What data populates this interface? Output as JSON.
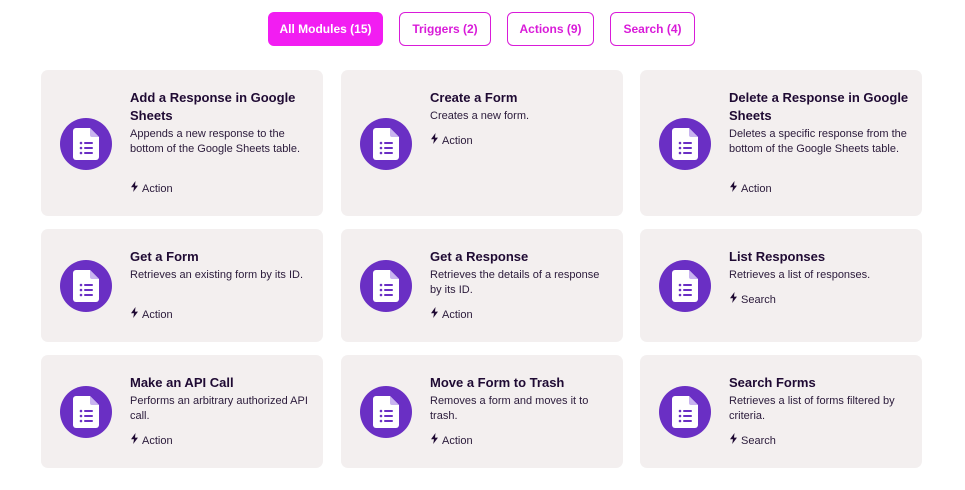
{
  "filters": [
    {
      "label": "All Modules (15)",
      "active": true
    },
    {
      "label": "Triggers (2)",
      "active": false
    },
    {
      "label": "Actions (9)",
      "active": false
    },
    {
      "label": "Search (4)",
      "active": false
    }
  ],
  "colors": {
    "accent": "#f21df2",
    "icon_bg": "#6a2fc4",
    "card_bg": "#f3efef"
  },
  "cards": [
    {
      "title": "Add a Response in Google Sheets",
      "description": "Appends a new response to the bottom of the Google Sheets table.",
      "type": "Action",
      "icon": "google-forms-icon"
    },
    {
      "title": "Create a Form",
      "description": "Creates a new form.",
      "type": "Action",
      "icon": "google-forms-icon"
    },
    {
      "title": "Delete a Response in Google Sheets",
      "description": "Deletes a specific response from the bottom of the Google Sheets table.",
      "type": "Action",
      "icon": "google-forms-icon"
    },
    {
      "title": "Get a Form",
      "description": "Retrieves an existing form by its ID.",
      "type": "Action",
      "icon": "google-forms-icon"
    },
    {
      "title": "Get a Response",
      "description": "Retrieves the details of a response by its ID.",
      "type": "Action",
      "icon": "google-forms-icon"
    },
    {
      "title": "List Responses",
      "description": "Retrieves a list of responses.",
      "type": "Search",
      "icon": "google-forms-icon"
    },
    {
      "title": "Make an API Call",
      "description": "Performs an arbitrary authorized API call.",
      "type": "Action",
      "icon": "google-forms-icon"
    },
    {
      "title": "Move a Form to Trash",
      "description": "Removes a form and moves it to trash.",
      "type": "Action",
      "icon": "google-forms-icon"
    },
    {
      "title": "Search Forms",
      "description": "Retrieves a list of forms filtered by criteria.",
      "type": "Search",
      "icon": "google-forms-icon"
    }
  ]
}
